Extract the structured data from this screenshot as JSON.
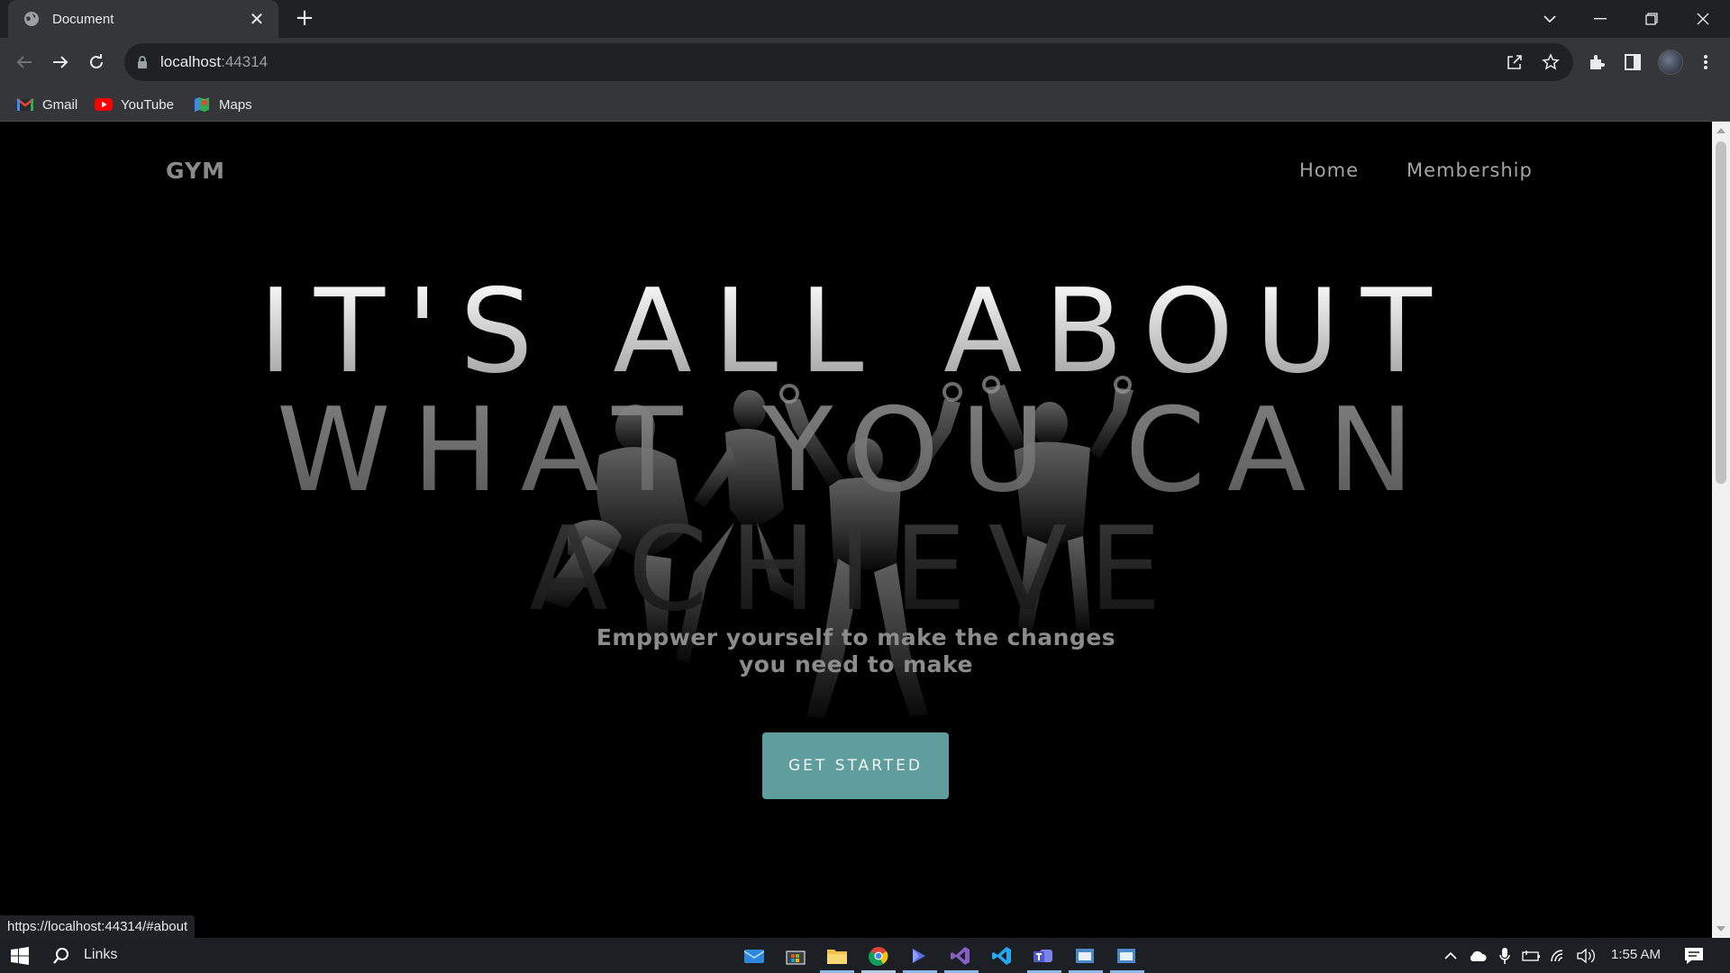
{
  "browser": {
    "tab_title": "Document",
    "tab_close": "✕",
    "new_tab": "+",
    "url_host": "localhost",
    "url_port": ":44314",
    "status_url": "https://localhost:44314/#about"
  },
  "bookmarks": [
    {
      "label": "Gmail",
      "icon": "gmail-icon"
    },
    {
      "label": "YouTube",
      "icon": "youtube-icon"
    },
    {
      "label": "Maps",
      "icon": "maps-icon"
    }
  ],
  "site": {
    "brand": "GYM",
    "nav": {
      "home": "Home",
      "membership": "Membership"
    },
    "hero": {
      "line1": "IT'S ALL ABOUT",
      "line2": "WHAT YOU CAN",
      "line3": "ACHIEVE"
    },
    "subtitle": "Emppwer yourself to make the changes you need to make",
    "cta": "GET STARTED"
  },
  "taskbar": {
    "search_label": "Links",
    "time": "1:55 AM"
  },
  "colors": {
    "accent_teal": "#5f9e9c",
    "chrome_dark": "#202124",
    "chrome_mid": "#35363a"
  }
}
